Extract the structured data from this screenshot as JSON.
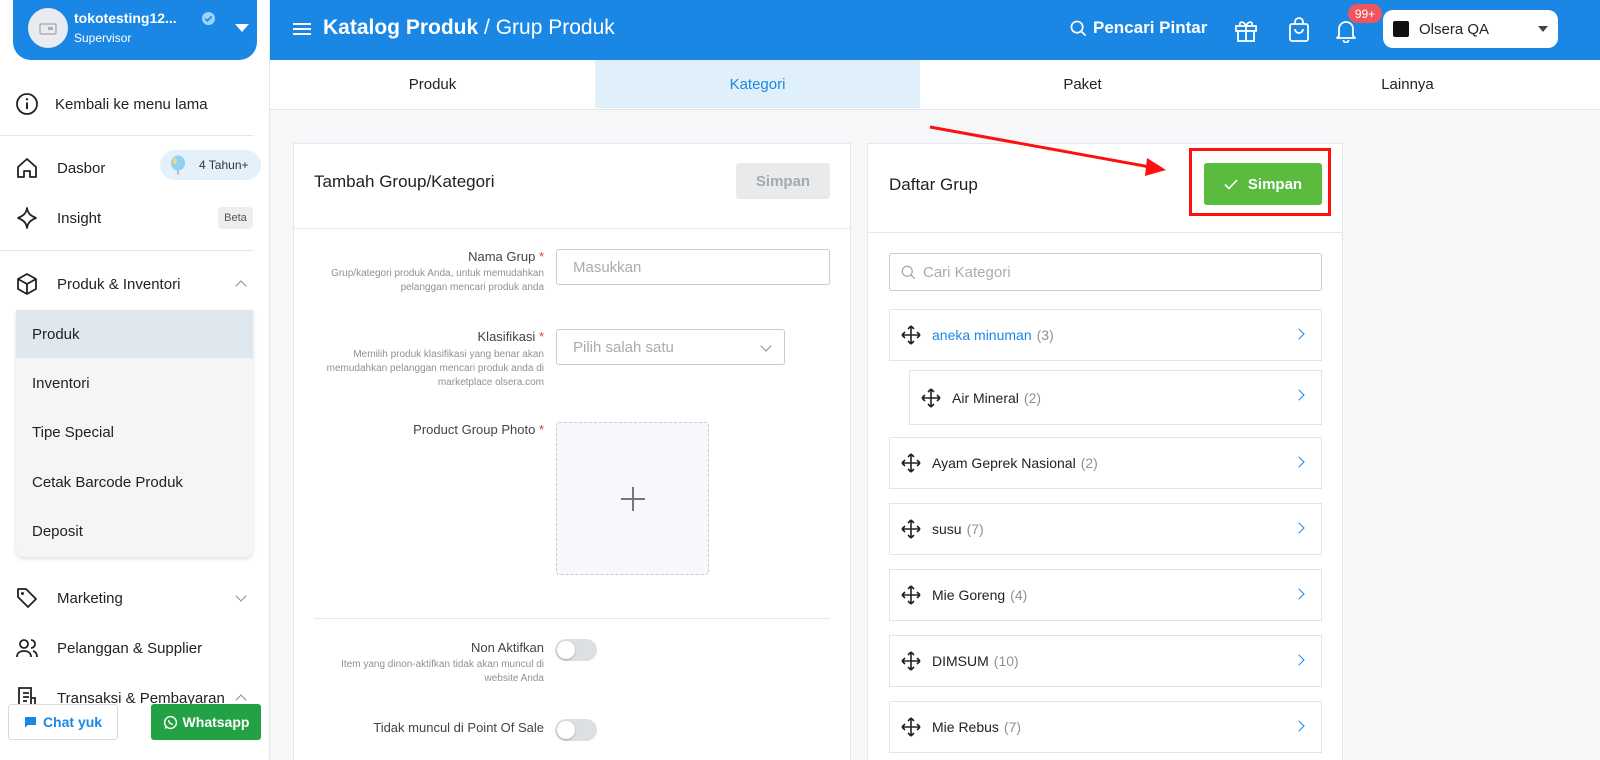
{
  "user": {
    "name": "tokotesting12...",
    "role": "Supervisor"
  },
  "sidebar": {
    "back_label": "Kembali ke menu lama",
    "dasbor": "Dasbor",
    "tahun_badge": "4 Tahun+",
    "insight": "Insight",
    "beta_badge": "Beta",
    "produk_inventori": "Produk & Inventori",
    "submenu": [
      "Produk",
      "Inventori",
      "Tipe Special",
      "Cetak Barcode Produk",
      "Deposit"
    ],
    "marketing": "Marketing",
    "pelanggan": "Pelanggan & Supplier",
    "transaksi": "Transaksi & Pembayaran"
  },
  "chat_btn": "Chat yuk",
  "wa_btn": "Whatsapp",
  "header": {
    "title_bold": "Katalog Produk",
    "title_rest": "/ Grup Produk",
    "smart_search": "Pencari Pintar",
    "notif_count": "99+",
    "store": "Olsera QA"
  },
  "tabs": [
    "Produk",
    "Kategori",
    "Paket",
    "Lainnya"
  ],
  "add_panel": {
    "title": "Tambah Group/Kategori",
    "save": "Simpan",
    "nama_label": "Nama Grup",
    "req": "*",
    "nama_help_1": "Grup/kategori produk Anda, untuk memudahkan",
    "nama_help_2": "pelanggan mencari produk anda",
    "nama_placeholder": "Masukkan",
    "klas_label": "Klasifikasi",
    "klas_help_1": "Memilih produk klasifikasi yang benar akan",
    "klas_help_2": "memudahkan pelanggan mencari produk anda di",
    "klas_help_3": "marketplace olsera.com",
    "klas_placeholder": "Pilih salah satu",
    "photo_label": "Product Group Photo",
    "non_aktif_label": "Non Aktifkan",
    "non_aktif_help_1": "Item yang dinon-aktifkan tidak akan muncul di",
    "non_aktif_help_2": "website Anda",
    "pos_label": "Tidak muncul di Point Of Sale"
  },
  "list_panel": {
    "title": "Daftar Grup",
    "save": "Simpan",
    "search_placeholder": "Cari Kategori",
    "items": [
      {
        "name": "aneka minuman",
        "count": "(3)"
      },
      {
        "name": "Air Mineral",
        "count": "(2)"
      },
      {
        "name": "Ayam Geprek Nasional",
        "count": "(2)"
      },
      {
        "name": "susu",
        "count": "(7)"
      },
      {
        "name": "Mie Goreng",
        "count": "(4)"
      },
      {
        "name": "DIMSUM",
        "count": "(10)"
      },
      {
        "name": "Mie Rebus",
        "count": "(7)"
      }
    ]
  },
  "colors": {
    "primary": "#1b87e5",
    "success": "#5bbb3f",
    "whatsapp": "#22a145",
    "highlight": "#ff1010"
  }
}
